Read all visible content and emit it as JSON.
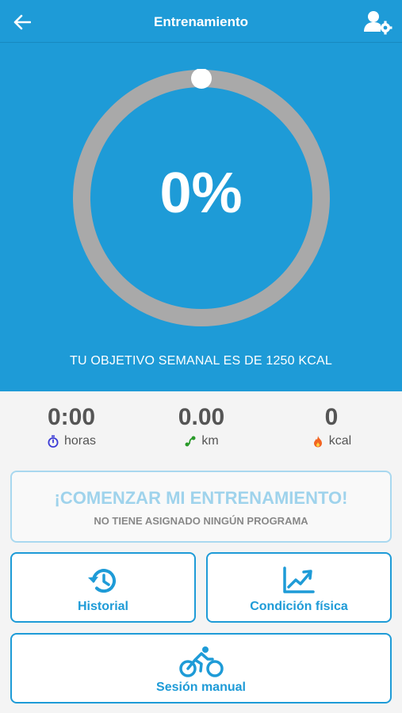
{
  "header": {
    "title": "Entrenamiento",
    "back_icon": "arrow-left-icon",
    "profile_icon": "user-settings-icon"
  },
  "progress": {
    "percent_label": "0%",
    "value": 0,
    "goal_text": "TU OBJETIVO SEMANAL ES DE 1250 KCAL"
  },
  "stats": [
    {
      "value": "0:00",
      "unit": "horas",
      "icon": "stopwatch-icon",
      "icon_color": "#3b3bd6"
    },
    {
      "value": "0.00",
      "unit": "km",
      "icon": "route-icon",
      "icon_color": "#2a9a2a"
    },
    {
      "value": "0",
      "unit": "kcal",
      "icon": "flame-icon",
      "icon_color": "#f26522"
    }
  ],
  "start_card": {
    "title": "¡COMENZAR MI ENTRENAMIENTO!",
    "subtitle": "NO TIENE ASIGNADO NINGÚN PROGRAMA"
  },
  "actions": {
    "history": {
      "label": "Historial",
      "icon": "history-icon"
    },
    "fitness": {
      "label": "Condición física",
      "icon": "chart-line-icon"
    },
    "manual": {
      "label": "Sesión manual",
      "icon": "cyclist-icon"
    }
  },
  "colors": {
    "primary": "#1e9bd7",
    "ring_track": "#a9a9a9",
    "background": "#f4f4f4"
  }
}
